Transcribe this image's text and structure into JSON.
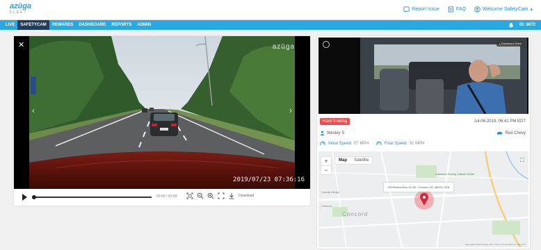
{
  "header": {
    "logo_main": "azūga",
    "logo_sub": "FLEET",
    "report_issue": "Report Issue",
    "faq": "FAQ",
    "welcome": "Welcome SafetyCam",
    "welcome_caret": "▾"
  },
  "nav": {
    "items": [
      {
        "label": "LIVE",
        "active": false
      },
      {
        "label": "SAFETYCAM",
        "active": true
      },
      {
        "label": "REWARDS",
        "active": false
      },
      {
        "label": "DASHBOARD",
        "active": false
      },
      {
        "label": "REPORTS",
        "active": false
      },
      {
        "label": "ADMIN",
        "active": false
      }
    ],
    "id_label": "ID: 8072"
  },
  "video": {
    "close_glyph": "✕",
    "brand": "azūga",
    "timestamp": "2019/07/23 07:36:16",
    "prev_glyph": "‹",
    "next_glyph": "›",
    "time_display": "00:00 / 00:08",
    "progress": 0.0,
    "download_label": "Download"
  },
  "event": {
    "download_video": "Download Video",
    "type": "Hard Braking",
    "date": "Jul-06-2019, 06:41 PM EDT",
    "driver": "Wesley S",
    "vehicle": "Red Chevy",
    "initial_speed_label": "Initial Speed",
    "initial_speed_value": "57 MPH",
    "final_speed_label": "Final Speed",
    "final_speed_value": "31 MPH"
  },
  "map": {
    "zoom_in": "+",
    "zoom_out": "−",
    "tab_map": "Map",
    "tab_satellite": "Satellite",
    "fullscreen_glyph": "⛶",
    "address": "269 Branchview Dr SE, Concord, NC 28025, USA",
    "place_1": "Cabarrus County Transit Center",
    "place_2": "County Library",
    "place_3": "Concord",
    "city": "Concord",
    "footer": "Map data ©2019 Google   200 m   Terms of Use   Report a map error"
  },
  "colors": {
    "nav_bg": "#29a9e1",
    "nav_active": "#1f3d5c",
    "accent": "#2a8fcf",
    "badge": "#e8504f"
  }
}
